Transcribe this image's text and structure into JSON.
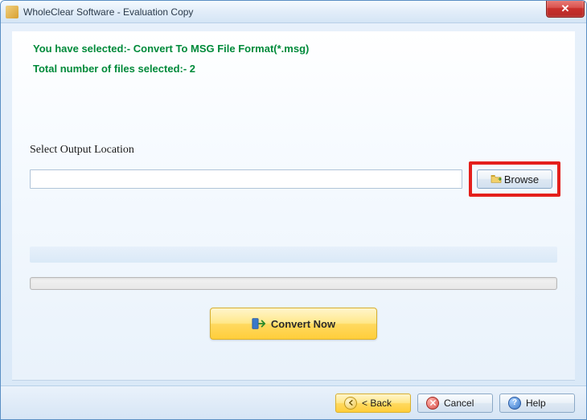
{
  "window": {
    "title": "WholeClear Software - Evaluation Copy"
  },
  "info": {
    "selected_format": "You have selected:- Convert To MSG File Format(*.msg)",
    "file_count": "Total number of files selected:- 2"
  },
  "output": {
    "label": "Select Output Location",
    "path": "",
    "browse_label": "Browse"
  },
  "actions": {
    "convert_label": "Convert Now"
  },
  "footer": {
    "back_label": "< Back",
    "cancel_label": "Cancel",
    "help_label": "Help"
  }
}
